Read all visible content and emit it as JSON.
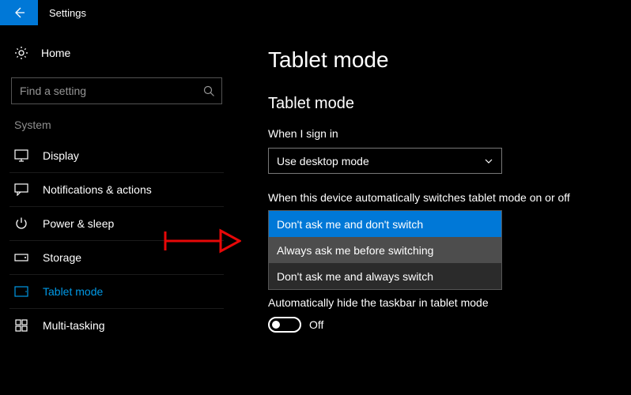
{
  "window": {
    "title": "Settings"
  },
  "sidebar": {
    "home": "Home",
    "search_placeholder": "Find a setting",
    "category": "System",
    "items": [
      {
        "label": "Display"
      },
      {
        "label": "Notifications & actions"
      },
      {
        "label": "Power & sleep"
      },
      {
        "label": "Storage"
      },
      {
        "label": "Tablet mode",
        "selected": true
      },
      {
        "label": "Multi-tasking"
      }
    ]
  },
  "main": {
    "title": "Tablet mode",
    "section_title": "Tablet mode",
    "signin_label": "When I sign in",
    "signin_value": "Use desktop mode",
    "autoswitch_label": "When this device automatically switches tablet mode on or off",
    "autoswitch_options": [
      "Don't ask me and don't switch",
      "Always ask me before switching",
      "Don't ask me and always switch"
    ],
    "autoswitch_selected_index": 0,
    "autohide_label": "Automatically hide the taskbar in tablet mode",
    "autohide_value": "Off"
  },
  "colors": {
    "accent": "#0078d7",
    "annotation": "#e70808"
  }
}
